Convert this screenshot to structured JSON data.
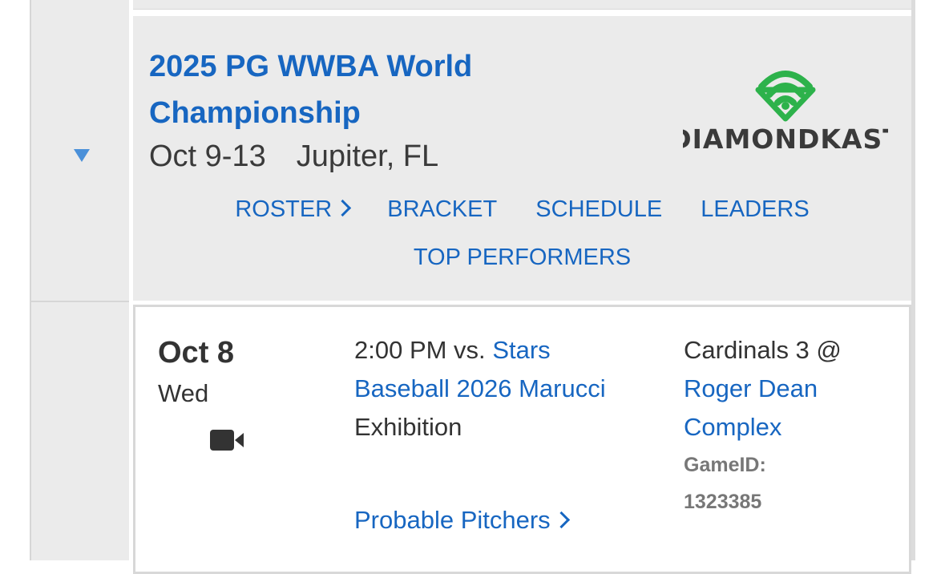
{
  "event": {
    "title": "2025 PG WWBA World Championship",
    "dates": "Oct 9-13",
    "location": "Jupiter, FL",
    "logo_text": "DIAMONDKAST",
    "nav": [
      "ROSTER",
      "BRACKET",
      "SCHEDULE",
      "LEADERS",
      "TOP PERFORMERS"
    ]
  },
  "game": {
    "date": "Oct 8",
    "day": "Wed",
    "time_vs": "2:00 PM vs.",
    "opponent": "Stars Baseball 2026 Marucci",
    "type": "Exhibition",
    "probable_pitchers": "Probable Pitchers",
    "field_prefix": "Cardinals 3 @",
    "venue": "Roger Dean Complex",
    "game_id_label": "GameID:",
    "game_id": "1323385"
  },
  "colors": {
    "link": "#1766c1",
    "panel_bg": "#ebebeb",
    "logo_green": "#2db24b",
    "caret": "#4a90d9"
  },
  "icons": {
    "expand": "caret-down-icon",
    "video": "video-camera-icon",
    "chevron": "chevron-right-icon"
  }
}
